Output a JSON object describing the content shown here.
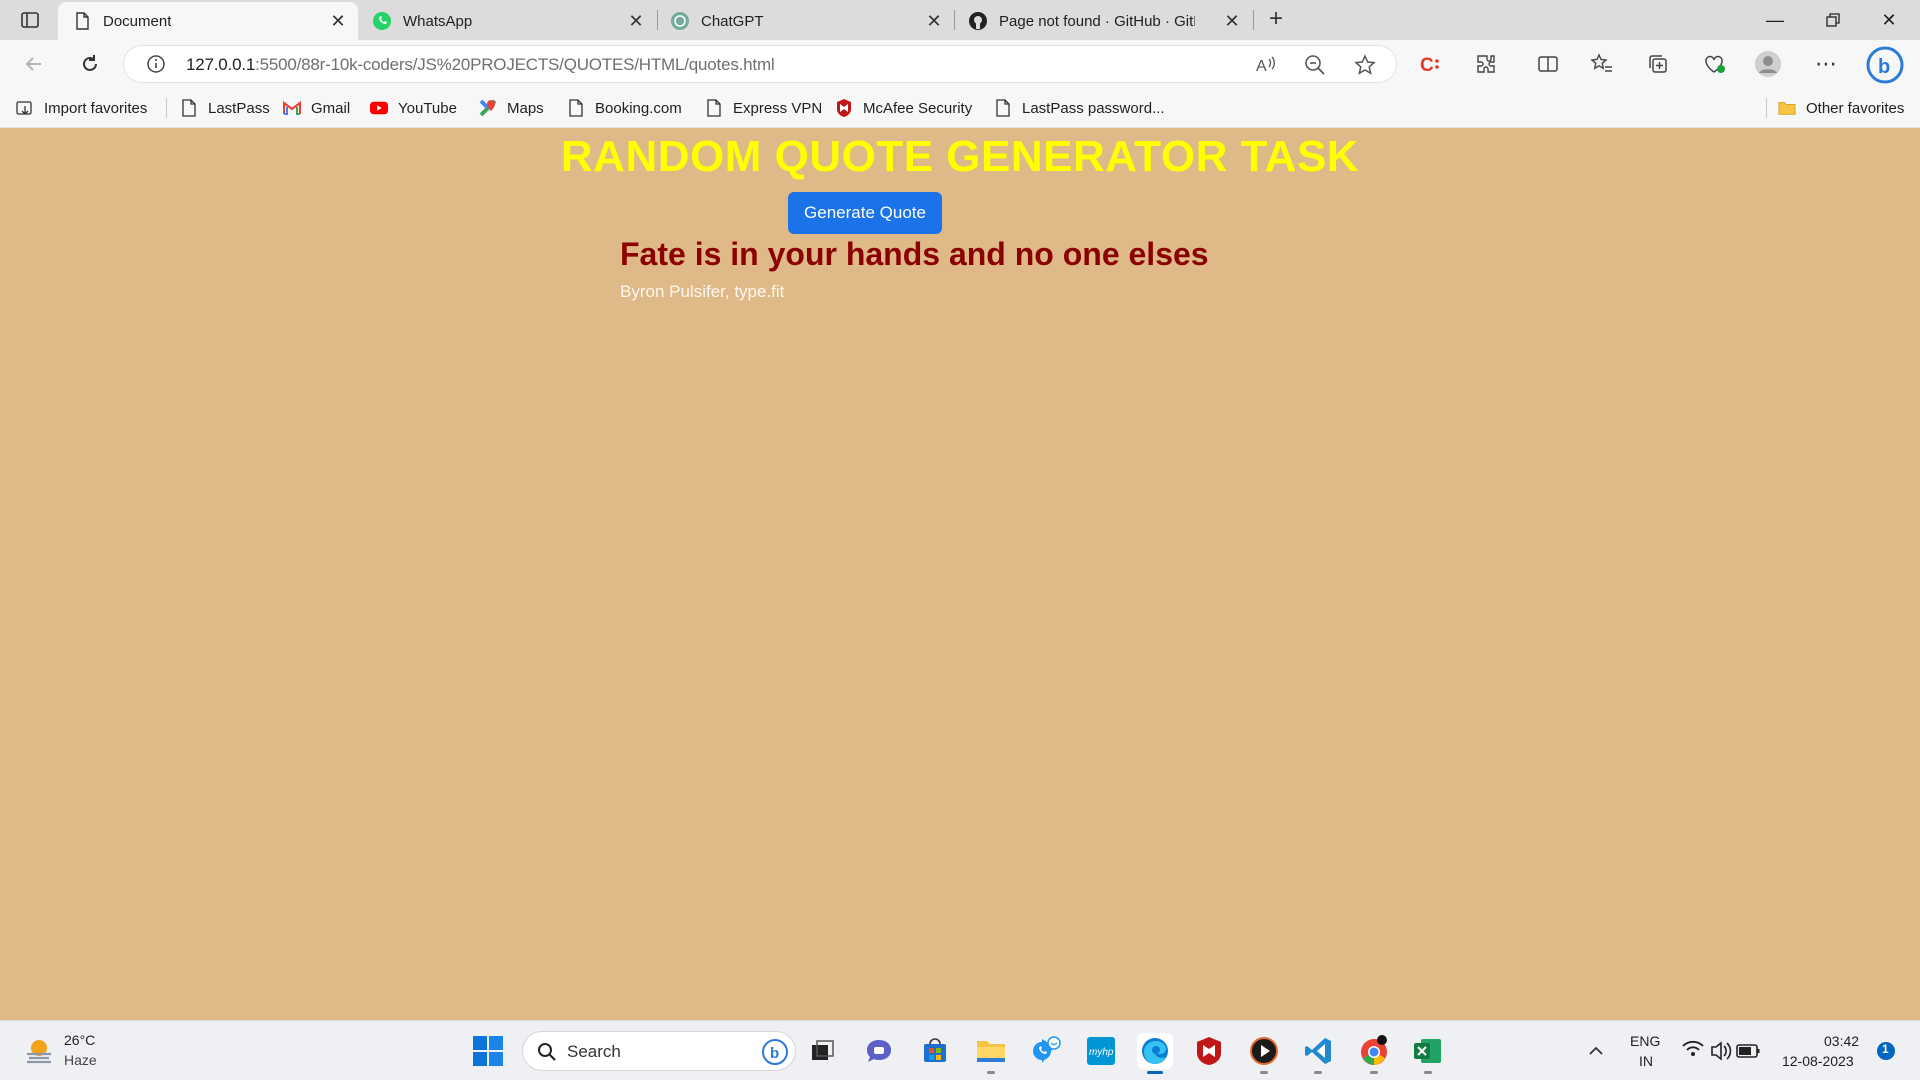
{
  "browser": {
    "tabs": [
      {
        "title": "Document",
        "active": true
      },
      {
        "title": "WhatsApp",
        "active": false
      },
      {
        "title": "ChatGPT",
        "active": false
      },
      {
        "title": "Page not found · GitHub · GitHub",
        "active": false
      }
    ],
    "address": {
      "host": "127.0.0.1",
      "rest": ":5500/88r-10k-coders/JS%20PROJECTS/QUOTES/HTML/quotes.html"
    },
    "favorites": [
      {
        "label": "Import favorites",
        "icon": "import-icon"
      },
      {
        "label": "LastPass",
        "icon": "page-icon"
      },
      {
        "label": "Gmail",
        "icon": "gmail-icon"
      },
      {
        "label": "YouTube",
        "icon": "youtube-icon"
      },
      {
        "label": "Maps",
        "icon": "maps-icon"
      },
      {
        "label": "Booking.com",
        "icon": "page-icon"
      },
      {
        "label": "Express VPN",
        "icon": "page-icon"
      },
      {
        "label": "McAfee Security",
        "icon": "mcafee-icon"
      },
      {
        "label": "LastPass password...",
        "icon": "page-icon"
      }
    ],
    "other_favorites": "Other favorites"
  },
  "page": {
    "title": "RANDOM QUOTE GENERATOR TASK",
    "button_label": "Generate Quote",
    "quote": "Fate is in your hands and no one elses",
    "author": "Byron Pulsifer, type.fit"
  },
  "taskbar": {
    "weather": {
      "temp": "26°C",
      "condition": "Haze"
    },
    "search_placeholder": "Search",
    "lang": {
      "line1": "ENG",
      "line2": "IN"
    },
    "clock": {
      "time": "03:42",
      "date": "12-08-2023"
    },
    "notification_count": "1"
  },
  "colors": {
    "page_background": "#dfb987",
    "title": "#ffff00",
    "button": "#1a73e8",
    "quote": "#8b0000"
  }
}
